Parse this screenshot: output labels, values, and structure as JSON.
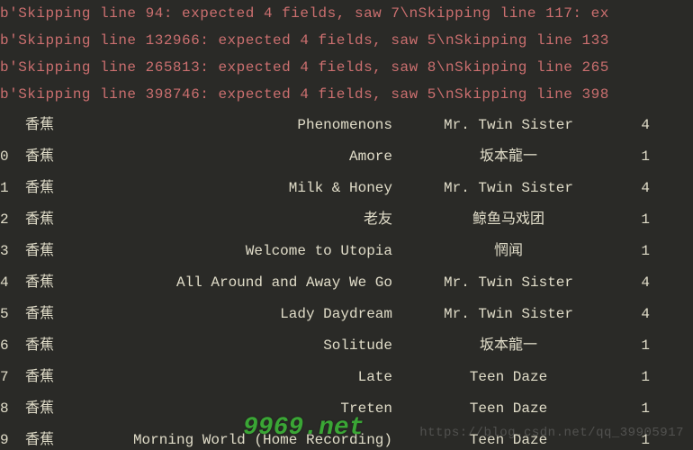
{
  "errors": [
    "b'Skipping line 94: expected 4 fields, saw 7\\nSkipping line 117: ex",
    "b'Skipping line 132966: expected 4 fields, saw 5\\nSkipping line 133",
    "b'Skipping line 265813: expected 4 fields, saw 8\\nSkipping line 265",
    "b'Skipping line 398746: expected 4 fields, saw 5\\nSkipping line 398"
  ],
  "header": {
    "user": "香蕉",
    "title": "Phenomenons",
    "artist": "Mr. Twin Sister",
    "count": "4"
  },
  "rows": [
    {
      "idx": "0",
      "user": "香蕉",
      "title": "Amore",
      "artist": "坂本龍一",
      "count": "1"
    },
    {
      "idx": "1",
      "user": "香蕉",
      "title": "Milk & Honey",
      "artist": "Mr. Twin Sister",
      "count": "4"
    },
    {
      "idx": "2",
      "user": "香蕉",
      "title": "老友",
      "artist": "鲸鱼马戏团",
      "count": "1"
    },
    {
      "idx": "3",
      "user": "香蕉",
      "title": "Welcome to Utopia",
      "artist": "惘闻",
      "count": "1"
    },
    {
      "idx": "4",
      "user": "香蕉",
      "title": "All Around and Away We Go",
      "artist": "Mr. Twin Sister",
      "count": "4"
    },
    {
      "idx": "5",
      "user": "香蕉",
      "title": "Lady Daydream",
      "artist": "Mr. Twin Sister",
      "count": "4"
    },
    {
      "idx": "6",
      "user": "香蕉",
      "title": "Solitude",
      "artist": "坂本龍一",
      "count": "1"
    },
    {
      "idx": "7",
      "user": "香蕉",
      "title": "Late",
      "artist": "Teen Daze",
      "count": "1"
    },
    {
      "idx": "8",
      "user": "香蕉",
      "title": "Treten",
      "artist": "Teen Daze",
      "count": "1"
    },
    {
      "idx": "9",
      "user": "香蕉",
      "title": "Morning World (Home Recording)",
      "artist": "Teen Daze",
      "count": "1"
    }
  ],
  "watermark_left": "9969.net",
  "watermark_right": "https://blog.csdn.net/qq_39905917"
}
